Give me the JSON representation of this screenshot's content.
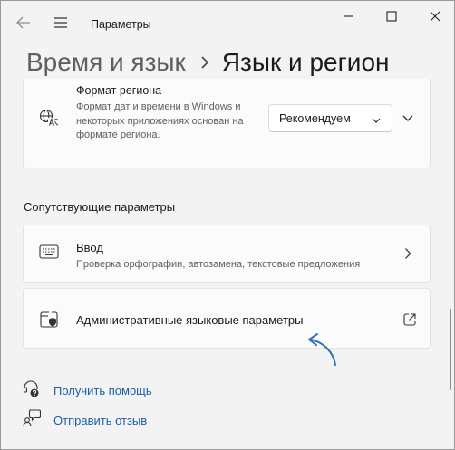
{
  "window": {
    "title": "Параметры",
    "icons": {
      "back": "arrow-left-icon",
      "menu": "hamburger-icon",
      "minimize": "minimize-icon",
      "maximize": "maximize-icon",
      "close": "close-icon"
    }
  },
  "breadcrumb": {
    "parent": "Время и язык",
    "current": "Язык и регион"
  },
  "region_format": {
    "title": "Формат региона",
    "description": "Формат дат и времени в Windows и некоторых приложениях основан на формате региона.",
    "selected_value": "Рекомендуем",
    "icon": "language-icon"
  },
  "related": {
    "section_title": "Сопутствующие параметры",
    "input": {
      "title": "Ввод",
      "description": "Проверка орфографии, автозамена, текстовые предложения",
      "icon": "keyboard-icon"
    },
    "admin": {
      "title": "Административные языковые параметры",
      "icon": "admin-shield-icon",
      "action_icon": "open-external-icon"
    }
  },
  "links": {
    "help": {
      "label": "Получить помощь",
      "icon": "help-icon"
    },
    "feedback": {
      "label": "Отправить отзыв",
      "icon": "feedback-icon"
    }
  },
  "colors": {
    "background": "#f3f3f3",
    "card": "#fbfbfb",
    "link": "#1a5ea8",
    "annotation_arrow": "#2f73b5"
  }
}
